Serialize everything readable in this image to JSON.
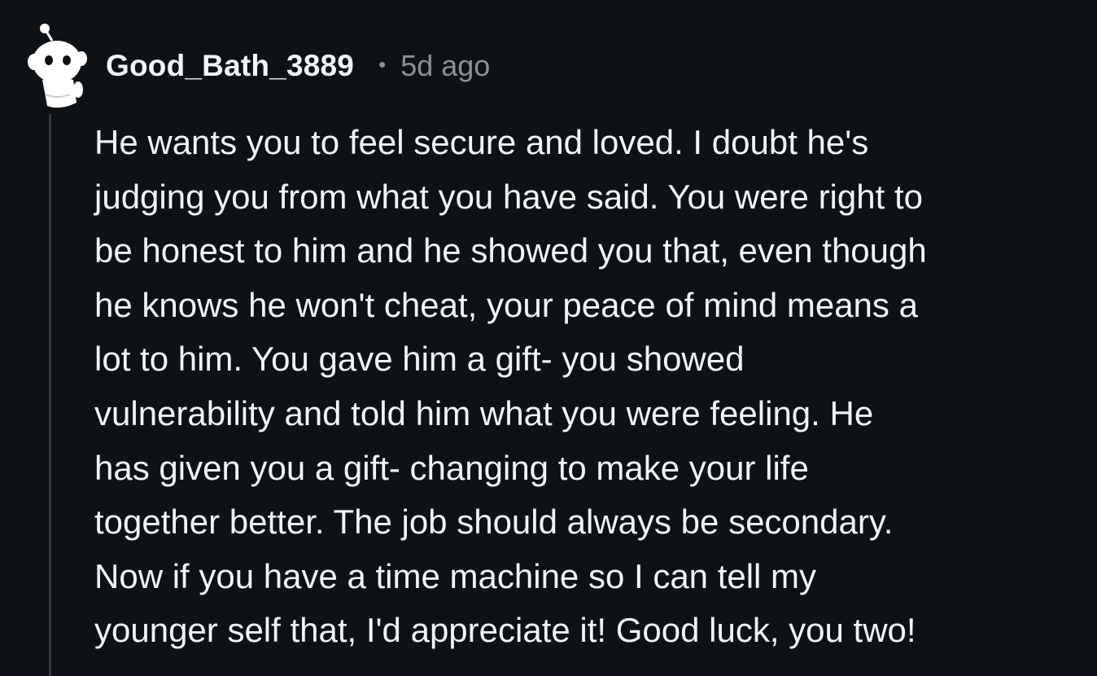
{
  "comment": {
    "author": "Good_Bath_3889",
    "separator": "•",
    "timestamp": "5d ago",
    "avatar_icon": "snoo-avatar-icon",
    "lines": [
      "He wants you to feel secure and loved. I doubt he's",
      "judging you from what you have said. You were right to",
      "be honest to him and he showed you that, even though",
      "he knows he won't cheat, your peace of mind means a",
      "lot to him. You gave him a gift- you showed",
      "vulnerability and told him what you were feeling. He",
      "has given you a gift- changing to make your life",
      "together better. The job should always be secondary.",
      "Now if you have a time machine so I can tell my",
      "younger self that, I'd appreciate it! Good luck, you two!"
    ]
  },
  "colors": {
    "background": "#0f1215",
    "text": "#f2f4f5",
    "muted": "#8a9196",
    "thread_line": "#343a40"
  }
}
